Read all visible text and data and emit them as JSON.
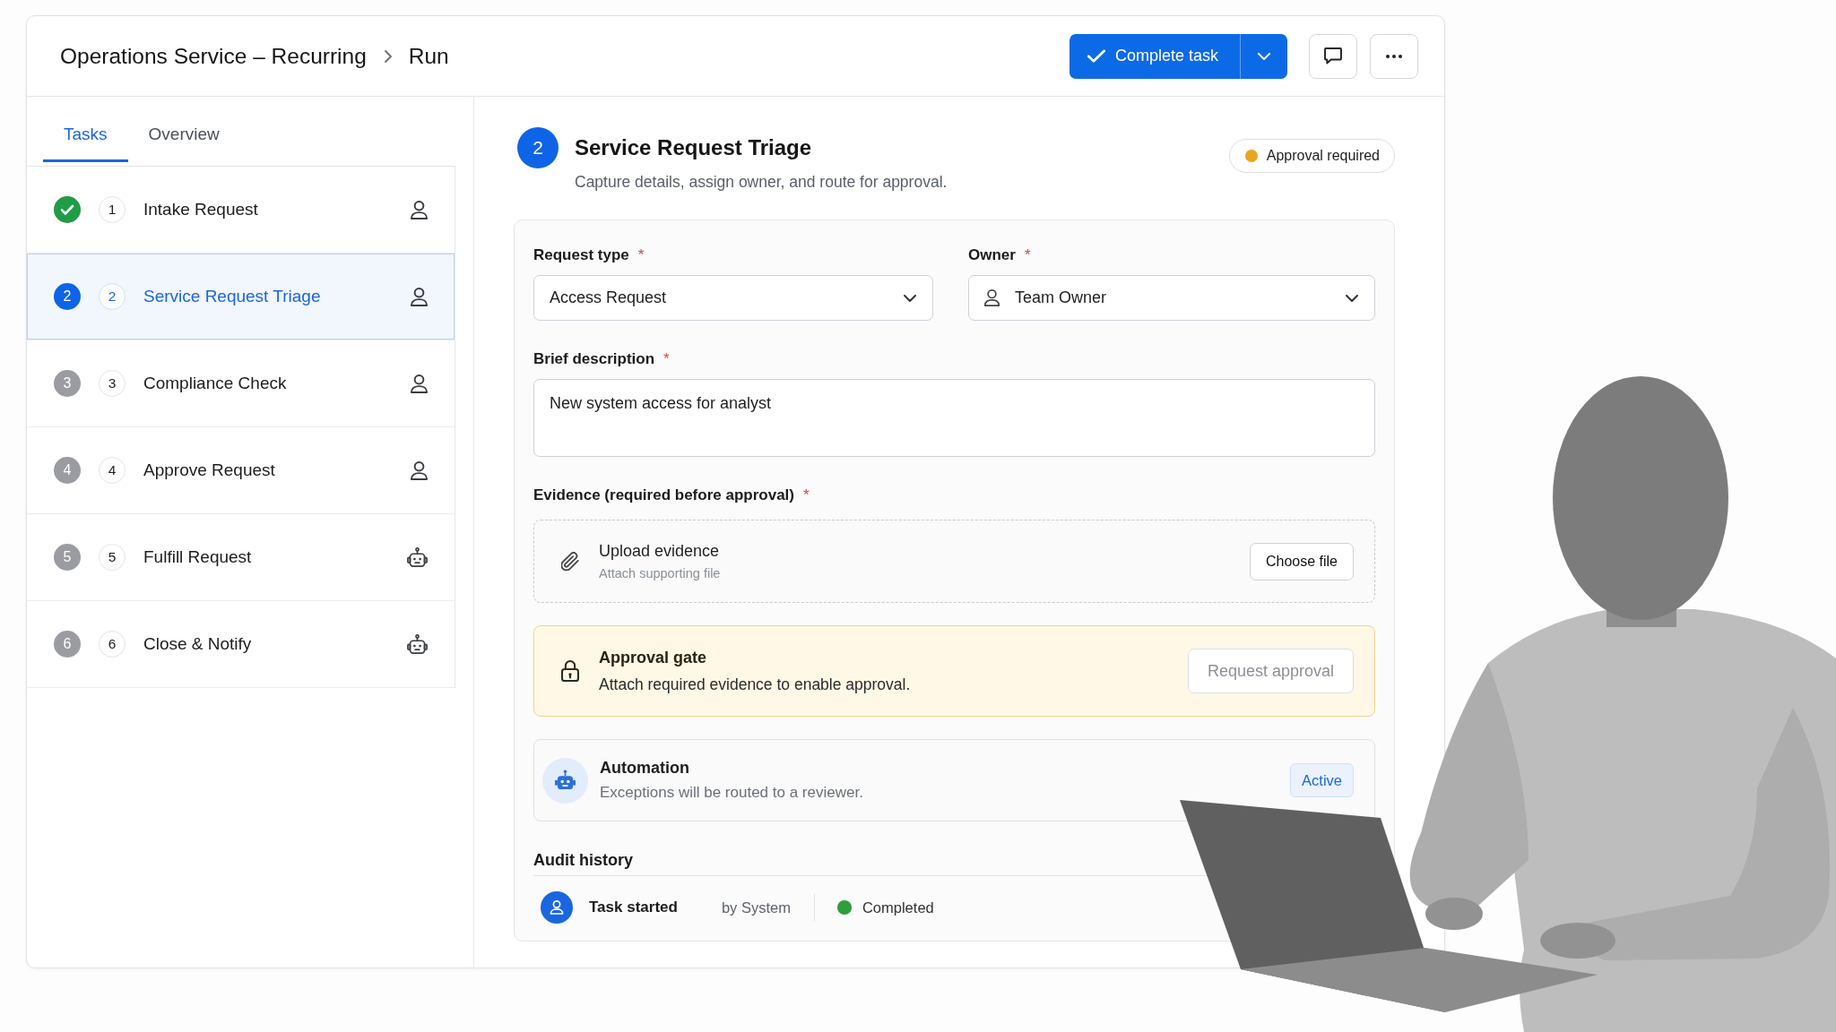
{
  "header": {
    "breadcrumb": [
      "Operations Service – Recurring",
      "Run"
    ],
    "primary_action": {
      "label": "Complete task",
      "menu": true
    }
  },
  "sidebar": {
    "tabs": [
      {
        "label": "Tasks",
        "selected": true
      },
      {
        "label": "Overview",
        "selected": false
      }
    ],
    "tasks": [
      {
        "kind": "person",
        "done": true,
        "number": "1",
        "name": "Intake Request",
        "selected": false
      },
      {
        "kind": "person",
        "done": false,
        "status_number": "2",
        "number": "2",
        "name": "Service Request Triage",
        "selected": true
      },
      {
        "kind": "person",
        "done": false,
        "status_number": "3",
        "number": "3",
        "name": "Compliance Check",
        "selected": false
      },
      {
        "kind": "person",
        "done": false,
        "status_number": "4",
        "number": "4",
        "name": "Approve Request",
        "selected": false
      },
      {
        "kind": "robot",
        "done": false,
        "status_number": "5",
        "number": "5",
        "name": "Fulfill Request",
        "selected": false
      },
      {
        "kind": "robot",
        "done": false,
        "status_number": "6",
        "number": "6",
        "name": "Close & Notify",
        "selected": false
      }
    ]
  },
  "task": {
    "step": "2",
    "title": "Service Request Triage",
    "subtitle": "Capture details, assign owner, and route for approval.",
    "status": {
      "label": "Approval required"
    }
  },
  "form": {
    "fields": [
      {
        "kind": "select",
        "label": "Request type",
        "required_mark": "*",
        "value": "Access Request"
      },
      {
        "kind": "picker",
        "label": "Owner",
        "required_mark": "*",
        "value": "Team Owner"
      },
      {
        "kind": "textarea",
        "label": "Brief description",
        "required_mark": "*",
        "value": "New system access for analyst"
      },
      {
        "kind": "upload",
        "label": "Evidence (required before approval)",
        "required_mark": "*",
        "title": "Upload evidence",
        "hint": "Attach supporting file",
        "button": "Choose file"
      }
    ],
    "approval_gate": {
      "title": "Approval gate",
      "message": "Attach required evidence to enable approval.",
      "button": {
        "label": "Request approval",
        "disabled": true
      }
    },
    "automation": {
      "title": "Automation",
      "message": "Exceptions will be routed to a reviewer.",
      "status": {
        "label": "Active",
        "active": true
      }
    },
    "audit_history": {
      "title": "Audit history",
      "entries": [
        {
          "kind": "success",
          "event": "Task started",
          "actor": "by System",
          "status": "Completed"
        }
      ]
    }
  }
}
